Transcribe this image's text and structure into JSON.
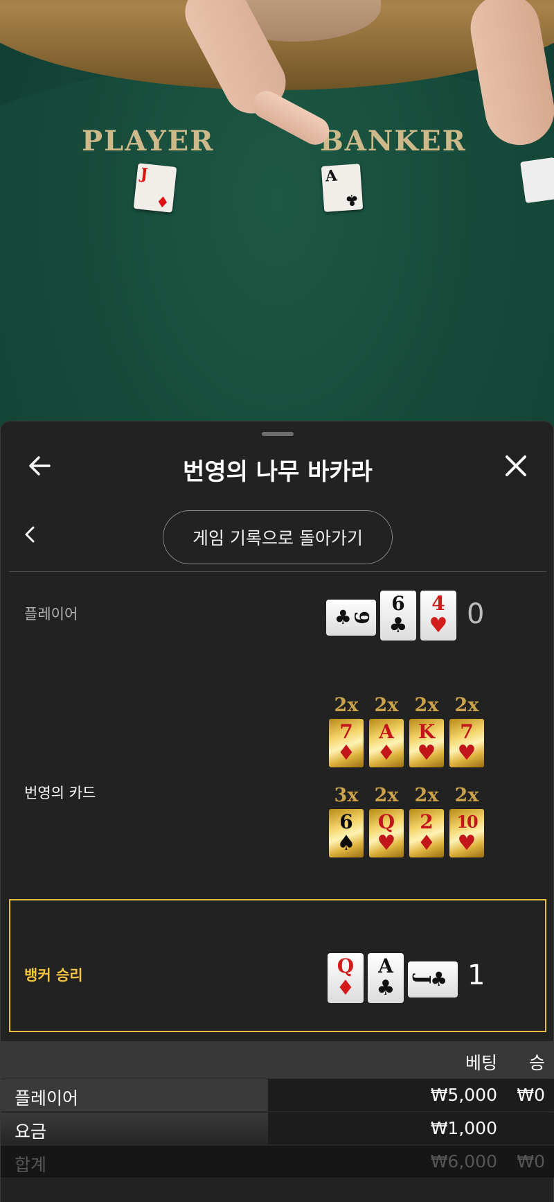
{
  "video": {
    "player_label": "PLAYER",
    "banker_label": "BANKER",
    "player_card": {
      "rank": "J",
      "suit": "♦"
    },
    "banker_card": {
      "rank": "A",
      "suit": "♣"
    }
  },
  "header": {
    "title": "번영의 나무 바카라"
  },
  "nav": {
    "back_to_history": "게임 기록으로 돌아가기"
  },
  "results": {
    "player": {
      "label": "플레이어",
      "side_card": {
        "rank": "9",
        "suit": "♣"
      },
      "cards": [
        {
          "rank": "6",
          "suit": "♣",
          "color": "black"
        },
        {
          "rank": "4",
          "suit": "♥",
          "color": "red"
        }
      ],
      "total": "0"
    },
    "bonus": {
      "label": "번영의 카드",
      "row1": [
        {
          "mult": "2x",
          "rank": "7",
          "suit": "♦"
        },
        {
          "mult": "2x",
          "rank": "A",
          "suit": "♦"
        },
        {
          "mult": "2x",
          "rank": "K",
          "suit": "♥"
        },
        {
          "mult": "2x",
          "rank": "7",
          "suit": "♥"
        }
      ],
      "row2": [
        {
          "mult": "3x",
          "rank": "6",
          "suit": "♠"
        },
        {
          "mult": "2x",
          "rank": "Q",
          "suit": "♥"
        },
        {
          "mult": "2x",
          "rank": "2",
          "suit": "♦"
        },
        {
          "mult": "2x",
          "rank": "10",
          "suit": "♥"
        }
      ]
    },
    "banker": {
      "label": "뱅커 승리",
      "cards": [
        {
          "rank": "Q",
          "suit": "♦",
          "color": "red"
        },
        {
          "rank": "A",
          "suit": "♣",
          "color": "black"
        }
      ],
      "side_card": {
        "rank": "J",
        "suit": "♣"
      },
      "total": "1"
    }
  },
  "bets": {
    "headers": {
      "bet": "베팅",
      "win": "승"
    },
    "rows": [
      {
        "name": "플레이어",
        "amount": "₩5,000",
        "win": "₩0"
      },
      {
        "name": "요금",
        "amount": "₩1,000",
        "win": ""
      },
      {
        "name": "합계",
        "amount": "₩6,000",
        "win": "₩0"
      }
    ]
  },
  "colors": {
    "accent_gold": "#e3c040",
    "banker_win_text": "#f5c542",
    "felt_green": "#164a3a"
  }
}
